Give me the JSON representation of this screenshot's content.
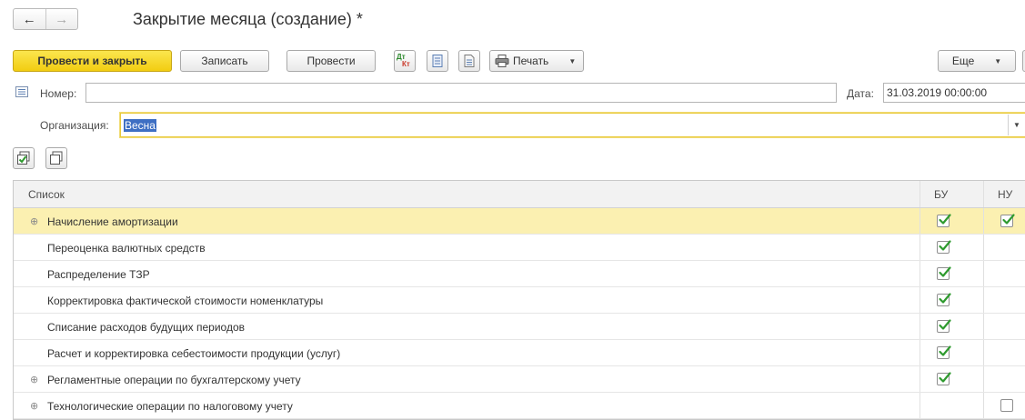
{
  "window": {
    "title": "Закрытие месяца (создание) *"
  },
  "nav": {
    "back_icon": "←",
    "forward_icon": "→"
  },
  "toolbar": {
    "post_close_label": "Провести и закрыть",
    "save_label": "Записать",
    "post_label": "Провести",
    "dt_kt_icon_top": "Дт",
    "dt_kt_icon_bottom": "Кт",
    "print_label": "Печать",
    "more_label": "Еще"
  },
  "form": {
    "number_label": "Номер:",
    "number_value": "",
    "date_label": "Дата:",
    "date_value": "31.03.2019 00:00:00",
    "org_label": "Организация:",
    "org_value": "Весна"
  },
  "table": {
    "columns": {
      "list": "Список",
      "bu": "БУ",
      "nu": "НУ"
    },
    "rows": [
      {
        "label": "Начисление амортизации",
        "expandable": true,
        "bu": true,
        "nu": true,
        "selected": true
      },
      {
        "label": "Переоценка валютных средств",
        "expandable": false,
        "bu": true,
        "nu": null,
        "selected": false
      },
      {
        "label": "Распределение ТЗР",
        "expandable": false,
        "bu": true,
        "nu": null,
        "selected": false
      },
      {
        "label": "Корректировка фактической стоимости номенклатуры",
        "expandable": false,
        "bu": true,
        "nu": null,
        "selected": false
      },
      {
        "label": "Списание расходов будущих периодов",
        "expandable": false,
        "bu": true,
        "nu": null,
        "selected": false
      },
      {
        "label": "Расчет и корректировка себестоимости продукции (услуг)",
        "expandable": false,
        "bu": true,
        "nu": null,
        "selected": false
      },
      {
        "label": "Регламентные операции по бухгалтерскому учету",
        "expandable": true,
        "bu": true,
        "nu": null,
        "selected": false
      },
      {
        "label": "Технологические операции по налоговому учету",
        "expandable": true,
        "bu": null,
        "nu": false,
        "selected": false
      }
    ]
  },
  "colors": {
    "primary_button": "#f2cd11",
    "selected_row": "#fbf0b1",
    "checkmark": "#2e9a2e",
    "selection": "#3e6fc3"
  }
}
